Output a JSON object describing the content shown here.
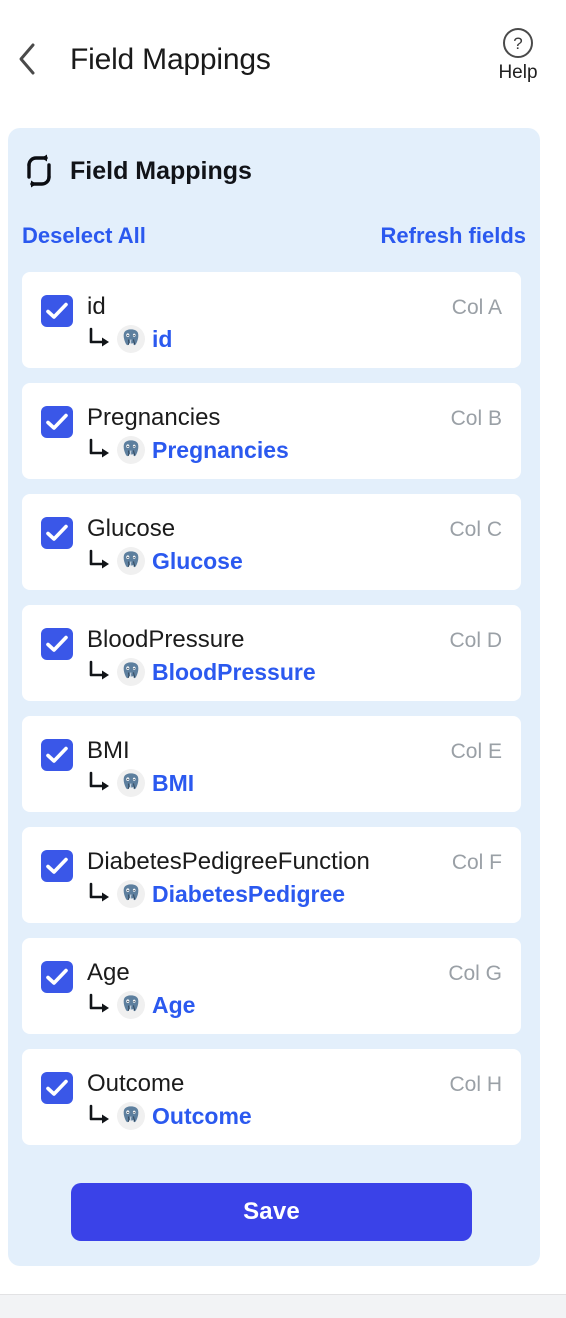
{
  "header": {
    "back_icon": "chevron-left-icon",
    "title": "Field Mappings",
    "help_icon": "question-circle-icon",
    "help_label": "Help"
  },
  "panel": {
    "icon": "sync-swap-icon",
    "title": "Field Mappings",
    "deselect_all_label": "Deselect All",
    "refresh_fields_label": "Refresh fields",
    "save_label": "Save"
  },
  "colors": {
    "accent_blue": "#3a57e8",
    "link_blue": "#2b59ef",
    "save_blue": "#3a42e8",
    "panel_bg": "#e3effb",
    "card_bg": "#ffffff",
    "col_tag_gray": "#9aa0a6"
  },
  "mappings": [
    {
      "source": "id",
      "target": "id",
      "column": "Col A",
      "checked": true,
      "db_icon": "postgresql-icon"
    },
    {
      "source": "Pregnancies",
      "target": "Pregnancies",
      "column": "Col B",
      "checked": true,
      "db_icon": "postgresql-icon"
    },
    {
      "source": "Glucose",
      "target": "Glucose",
      "column": "Col C",
      "checked": true,
      "db_icon": "postgresql-icon"
    },
    {
      "source": "BloodPressure",
      "target": "BloodPressure",
      "column": "Col D",
      "checked": true,
      "db_icon": "postgresql-icon"
    },
    {
      "source": "BMI",
      "target": "BMI",
      "column": "Col E",
      "checked": true,
      "db_icon": "postgresql-icon"
    },
    {
      "source": "DiabetesPedigreeFunction",
      "target": "DiabetesPedigree",
      "column": "Col F",
      "checked": true,
      "db_icon": "postgresql-icon"
    },
    {
      "source": "Age",
      "target": "Age",
      "column": "Col G",
      "checked": true,
      "db_icon": "postgresql-icon"
    },
    {
      "source": "Outcome",
      "target": "Outcome",
      "column": "Col H",
      "checked": true,
      "db_icon": "postgresql-icon"
    }
  ]
}
